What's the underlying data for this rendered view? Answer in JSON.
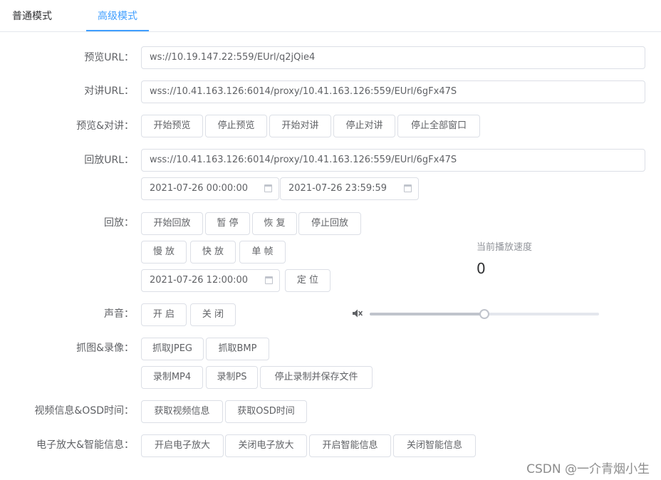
{
  "tabs": [
    "普通模式",
    "高级模式"
  ],
  "preview": {
    "label": "预览URL：",
    "value": "ws://10.19.147.22:559/EUrl/q2jQie4"
  },
  "talk": {
    "label": "对讲URL：",
    "value": "wss://10.41.163.126:6014/proxy/10.41.163.126:559/EUrl/6gFx47S"
  },
  "preview_talk": {
    "label": "预览&对讲：",
    "buttons": [
      "开始预览",
      "停止预览",
      "开始对讲",
      "停止对讲",
      "停止全部窗口"
    ]
  },
  "playback_url": {
    "label": "回放URL：",
    "value": "wss://10.41.163.126:6014/proxy/10.41.163.126:559/EUrl/6gFx47S"
  },
  "range": {
    "start": "2021-07-26 00:00:00",
    "end": "2021-07-26 23:59:59"
  },
  "playback": {
    "label": "回放：",
    "row1": [
      "开始回放",
      "暂 停",
      "恢 复",
      "停止回放"
    ],
    "row2": [
      "慢 放",
      "快 放",
      "单 帧"
    ],
    "seek_time": "2021-07-26 12:00:00",
    "seek_button": "定 位",
    "speed_label": "当前播放速度",
    "speed_value": "0"
  },
  "sound": {
    "label": "声音：",
    "buttons": [
      "开 启",
      "关 闭"
    ],
    "volume": 0.5,
    "icon": "mute-icon"
  },
  "capture": {
    "label": "抓图&录像：",
    "row1": [
      "抓取JPEG",
      "抓取BMP"
    ],
    "row2": [
      "录制MP4",
      "录制PS",
      "停止录制并保存文件"
    ]
  },
  "video_info": {
    "label": "视频信息&OSD时间：",
    "buttons": [
      "获取视频信息",
      "获取OSD时间"
    ]
  },
  "zoom": {
    "label": "电子放大&智能信息：",
    "buttons": [
      "开启电子放大",
      "关闭电子放大",
      "开启智能信息",
      "关闭智能信息"
    ]
  },
  "watermark": "CSDN @一介青烟小生",
  "colors": {
    "accent": "#409eff",
    "border": "#dcdfe6",
    "text": "#606266"
  }
}
